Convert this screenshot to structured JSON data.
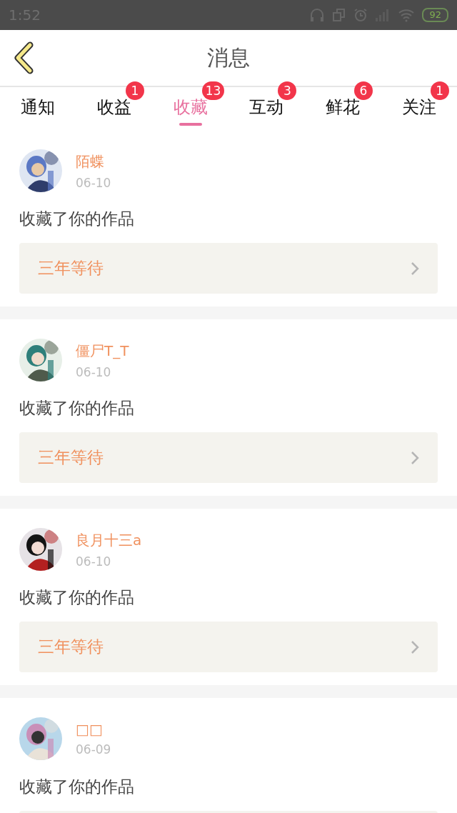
{
  "status_bar": {
    "time": "1:52",
    "battery": "92"
  },
  "header": {
    "title": "消息"
  },
  "tabs": [
    {
      "label": "通知",
      "selected": false
    },
    {
      "label": "收益",
      "selected": false,
      "badge": "1"
    },
    {
      "label": "收藏",
      "selected": true,
      "badge": "13"
    },
    {
      "label": "互动",
      "selected": false,
      "badge": "3"
    },
    {
      "label": "鲜花",
      "selected": false,
      "badge": "6"
    },
    {
      "label": "关注",
      "selected": false,
      "badge": "1"
    }
  ],
  "messages": [
    {
      "name": "陌蝶",
      "date": "06-10",
      "text": "收藏了你的作品",
      "work": "三年等待"
    },
    {
      "name": "僵尸T_T",
      "date": "06-10",
      "text": "收藏了你的作品",
      "work": "三年等待"
    },
    {
      "name": "良月十三a",
      "date": "06-10",
      "text": "收藏了你的作品",
      "work": "三年等待"
    },
    {
      "name": "□□",
      "date": "06-09",
      "text": "收藏了你的作品"
    }
  ]
}
